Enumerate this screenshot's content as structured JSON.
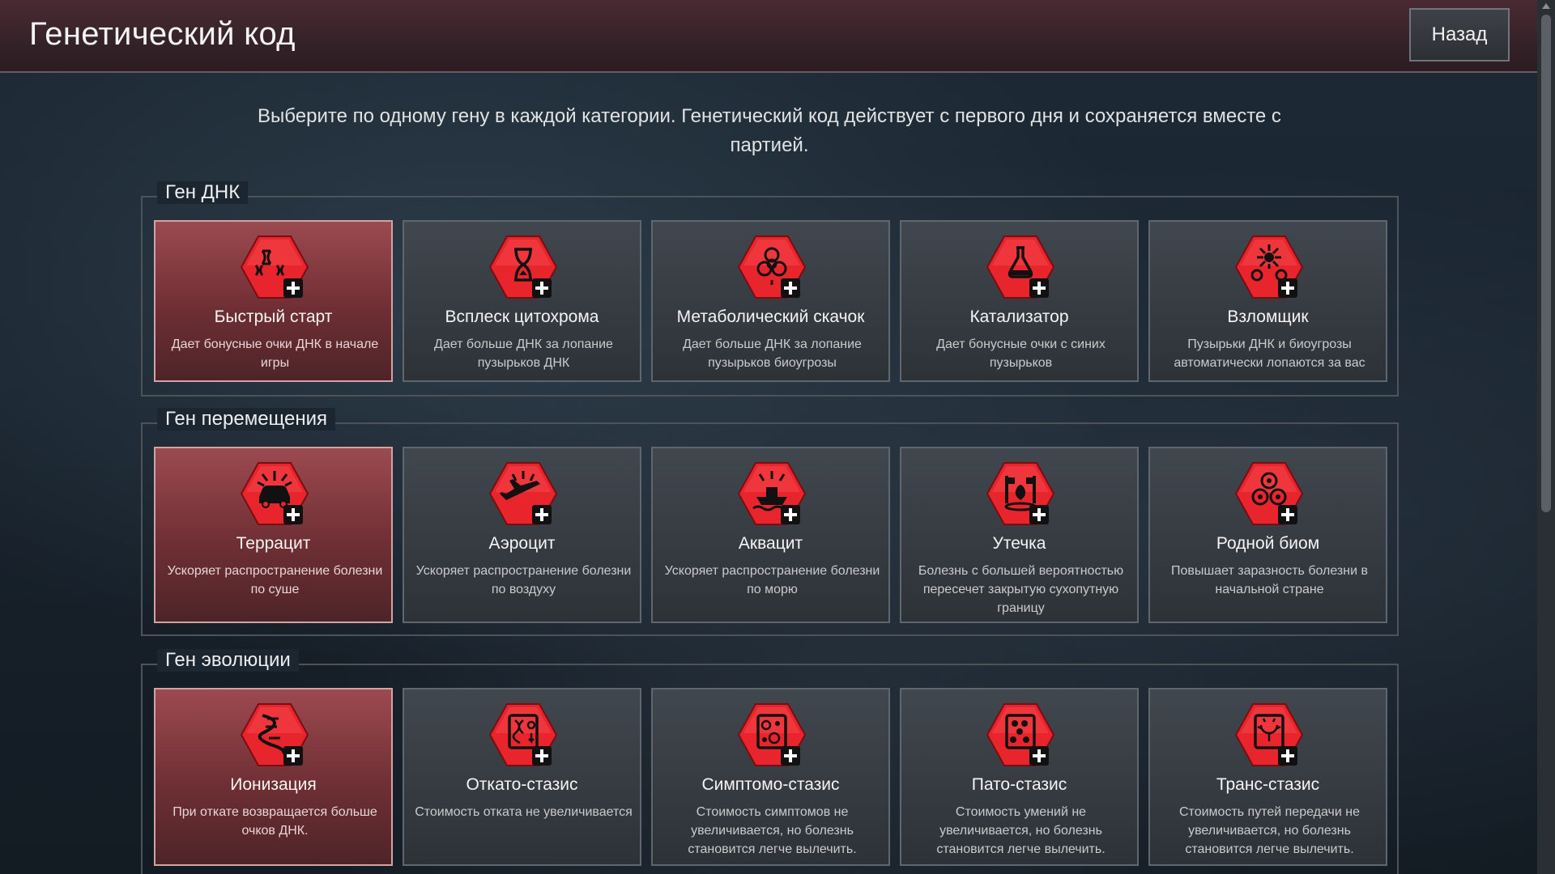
{
  "header": {
    "title": "Генетический код",
    "back_label": "Назад"
  },
  "instructions": "Выберите по одному гену в каждой категории. Генетический код действует с первого дня и сохраняется вместе с партией.",
  "colors": {
    "accent_red": "#e8242c",
    "selected_card": "#8a3d43",
    "card_bg": "#3a4046"
  },
  "sections": [
    {
      "title": "Ген ДНК",
      "cards": [
        {
          "name": "Быстрый старт",
          "desc": "Дает бонусные очки ДНК в начале игры",
          "icon": "dna-strands-icon",
          "selected": true
        },
        {
          "name": "Всплеск цитохрома",
          "desc": "Дает больше ДНК за лопание пузырьков ДНК",
          "icon": "hourglass-icon",
          "selected": false
        },
        {
          "name": "Метаболический скачок",
          "desc": "Дает больше ДНК за лопание пузырьков биоугрозы",
          "icon": "biohazard-icon",
          "selected": false
        },
        {
          "name": "Катализатор",
          "desc": "Дает бонусные очки с синих пузырьков",
          "icon": "flask-icon",
          "selected": false
        },
        {
          "name": "Взломщик",
          "desc": "Пузырьки ДНК и биоугрозы автоматически лопаются за вас",
          "icon": "burst-icon",
          "selected": false
        }
      ]
    },
    {
      "title": "Ген перемещения",
      "cards": [
        {
          "name": "Террацит",
          "desc": "Ускоряет распространение болезни по суше",
          "icon": "car-icon",
          "selected": true
        },
        {
          "name": "Аэроцит",
          "desc": "Ускоряет распространение болезни по воздуху",
          "icon": "plane-icon",
          "selected": false
        },
        {
          "name": "Аквацит",
          "desc": "Ускоряет распространение болезни по морю",
          "icon": "ship-icon",
          "selected": false
        },
        {
          "name": "Утечка",
          "desc": "Болезнь с большей вероятностью пересечет закрытую сухопутную границу",
          "icon": "border-leak-icon",
          "selected": false
        },
        {
          "name": "Родной биом",
          "desc": "Повышает заразность болезни в начальной стране",
          "icon": "biohazard-cluster-icon",
          "selected": false
        }
      ]
    },
    {
      "title": "Ген эволюции",
      "cards": [
        {
          "name": "Ионизация",
          "desc": "При откате возвращается больше очков ДНК.",
          "icon": "dna-helix-icon",
          "selected": true
        },
        {
          "name": "Откато-стазис",
          "desc": "Стоимость отката не увеличивается",
          "icon": "dna-box-icon",
          "selected": false
        },
        {
          "name": "Симптомо-стазис",
          "desc": "Стоимость симптомов не увеличивается, но болезнь становится легче вылечить.",
          "icon": "cells-box-icon",
          "selected": false
        },
        {
          "name": "Пато-стазис",
          "desc": "Стоимость умений не увеличивается, но болезнь становится легче вылечить.",
          "icon": "hex-cells-box-icon",
          "selected": false
        },
        {
          "name": "Транс-стазис",
          "desc": "Стоимость путей передачи не увеличивается, но болезнь становится легче вылечить.",
          "icon": "spread-box-icon",
          "selected": false
        }
      ]
    }
  ]
}
